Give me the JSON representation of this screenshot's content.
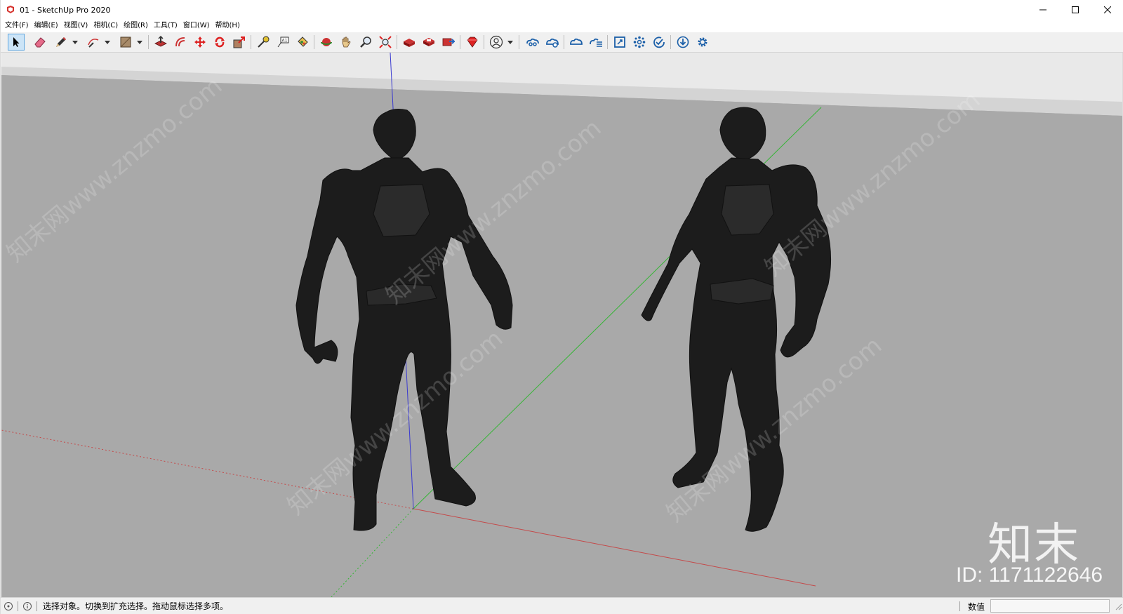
{
  "window": {
    "title": "01 - SketchUp Pro 2020",
    "controls": [
      "minimize",
      "maximize",
      "close"
    ]
  },
  "menu": {
    "items": [
      "文件(F)",
      "编辑(E)",
      "视图(V)",
      "相机(C)",
      "绘图(R)",
      "工具(T)",
      "窗口(W)",
      "帮助(H)"
    ]
  },
  "toolbar": {
    "tools": [
      {
        "name": "select-tool",
        "icon": "arrow-cursor-icon"
      },
      {
        "name": "eraser-tool",
        "icon": "eraser-icon"
      },
      {
        "name": "line-tool",
        "icon": "pencil-icon"
      },
      {
        "name": "arc-tool",
        "icon": "arc-icon"
      },
      {
        "name": "shape-tool",
        "icon": "rectangle-icon"
      },
      {
        "name": "push-pull-tool",
        "icon": "push-pull-icon"
      },
      {
        "name": "offset-tool",
        "icon": "offset-icon"
      },
      {
        "name": "move-tool",
        "icon": "move-icon"
      },
      {
        "name": "rotate-tool",
        "icon": "rotate-icon"
      },
      {
        "name": "scale-tool",
        "icon": "scale-icon"
      },
      {
        "name": "tape-measure-tool",
        "icon": "tape-measure-icon"
      },
      {
        "name": "text-tool",
        "icon": "text-icon"
      },
      {
        "name": "paint-bucket-tool",
        "icon": "paint-bucket-icon"
      },
      {
        "name": "orbit-tool",
        "icon": "orbit-icon"
      },
      {
        "name": "pan-tool",
        "icon": "hand-icon"
      },
      {
        "name": "zoom-tool",
        "icon": "magnifier-icon"
      },
      {
        "name": "zoom-extents-tool",
        "icon": "zoom-extents-icon"
      },
      {
        "name": "warehouse-tool",
        "icon": "warehouse-icon"
      },
      {
        "name": "extension-warehouse-tool",
        "icon": "extension-warehouse-icon"
      },
      {
        "name": "send-to-layout-tool",
        "icon": "layout-icon"
      },
      {
        "name": "extension-manager-tool",
        "icon": "ruby-gem-icon"
      },
      {
        "name": "account-button",
        "icon": "user-icon"
      },
      {
        "name": "trimble-connect-tool",
        "icon": "cloud-chain-icon"
      },
      {
        "name": "collaborate-tool",
        "icon": "cloud-share-icon"
      },
      {
        "name": "cloud-sync-tool",
        "icon": "cloud-sync-icon"
      },
      {
        "name": "cloud-list-tool",
        "icon": "cloud-list-icon"
      },
      {
        "name": "layout-page-tool",
        "icon": "page-icon"
      },
      {
        "name": "components-tool",
        "icon": "components-icon"
      },
      {
        "name": "check-tool",
        "icon": "check-circle-icon"
      },
      {
        "name": "download-tool",
        "icon": "download-icon"
      },
      {
        "name": "settings-tool",
        "icon": "gear-icon"
      }
    ]
  },
  "viewport": {
    "watermark_logo": "知末",
    "watermark_id": "ID: 1171122646",
    "watermark_text": "知末网www.znzmo.com"
  },
  "status": {
    "hint": "选择对象。切换到扩充选择。拖动鼠标选择多项。",
    "measurements_label": "数值",
    "measurements_value": ""
  },
  "colors": {
    "viewport_bg": "#a8a8a8",
    "sky": "#e6e6e6",
    "model": "#1c1c1c",
    "axis_red": "#c44a4a",
    "axis_green": "#35b535",
    "axis_blue": "#3a3ad0",
    "select_highlight": "#cce4f7"
  }
}
